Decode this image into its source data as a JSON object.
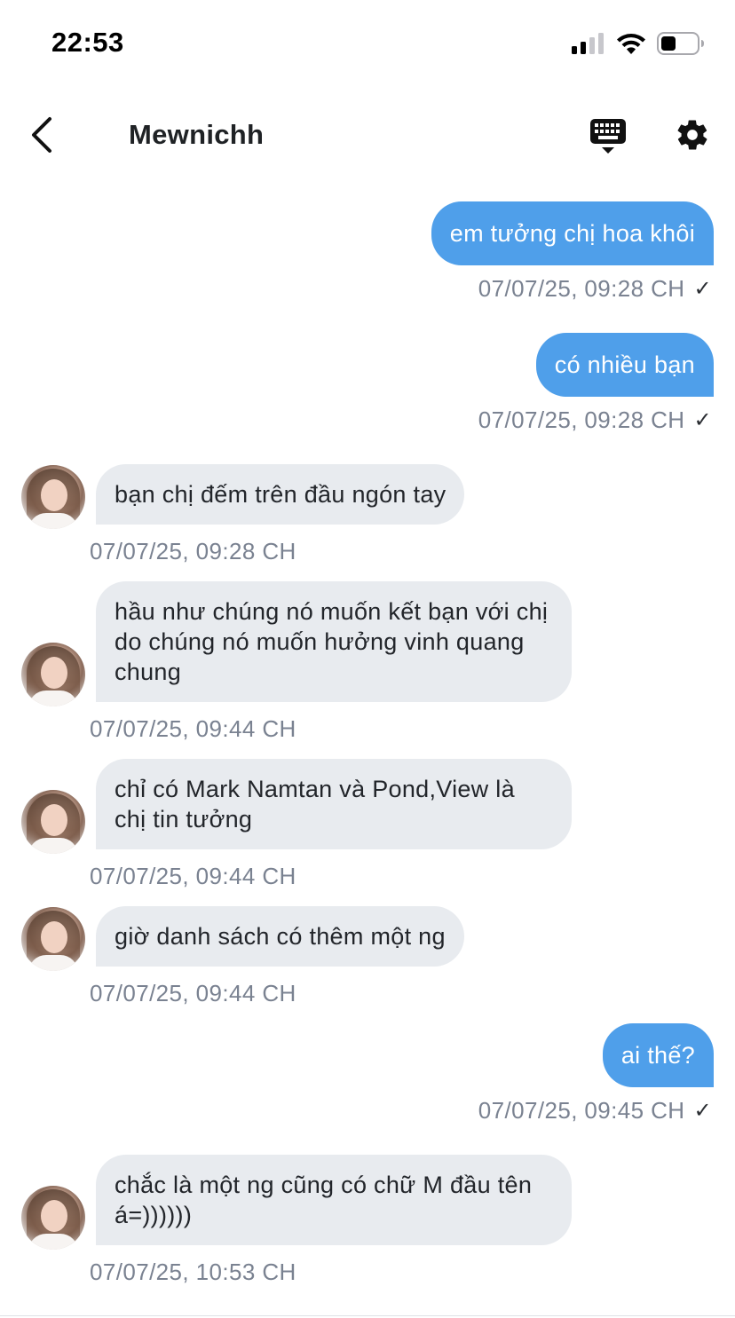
{
  "status_bar": {
    "time": "22:53"
  },
  "header": {
    "title": "Mewnichh"
  },
  "messages": [
    {
      "dir": "out",
      "text": "em tưởng chị hoa khôi",
      "time": "07/07/25, 09:28 CH",
      "status": "✓"
    },
    {
      "dir": "out",
      "text": "có nhiều bạn",
      "time": "07/07/25, 09:28 CH",
      "status": "✓"
    },
    {
      "dir": "in",
      "text": "bạn chị đếm trên đầu ngón tay",
      "time": "07/07/25, 09:28 CH"
    },
    {
      "dir": "in",
      "text": "hầu như chúng nó muốn kết bạn với chị do chúng nó muốn hưởng vinh quang chung",
      "time": "07/07/25, 09:44 CH"
    },
    {
      "dir": "in",
      "text": "chỉ có Mark Namtan và Pond,View là chị tin tưởng",
      "time": "07/07/25, 09:44 CH"
    },
    {
      "dir": "in",
      "text": "giờ danh sách có thêm một ng",
      "time": "07/07/25, 09:44 CH"
    },
    {
      "dir": "out",
      "text": "ai thế?",
      "time": "07/07/25, 09:45 CH",
      "status": "✓"
    },
    {
      "dir": "in",
      "text": "chắc là một ng cũng có chữ M đầu tên á=))))))",
      "time": "07/07/25, 10:53 CH"
    }
  ],
  "icons": {
    "back": "chevron-left-icon",
    "keyboard": "keyboard-icon",
    "settings": "gear-icon"
  },
  "colors": {
    "outgoing_bubble": "#4f9fea",
    "incoming_bubble": "#e8ebef",
    "timestamp": "#7a8291"
  }
}
